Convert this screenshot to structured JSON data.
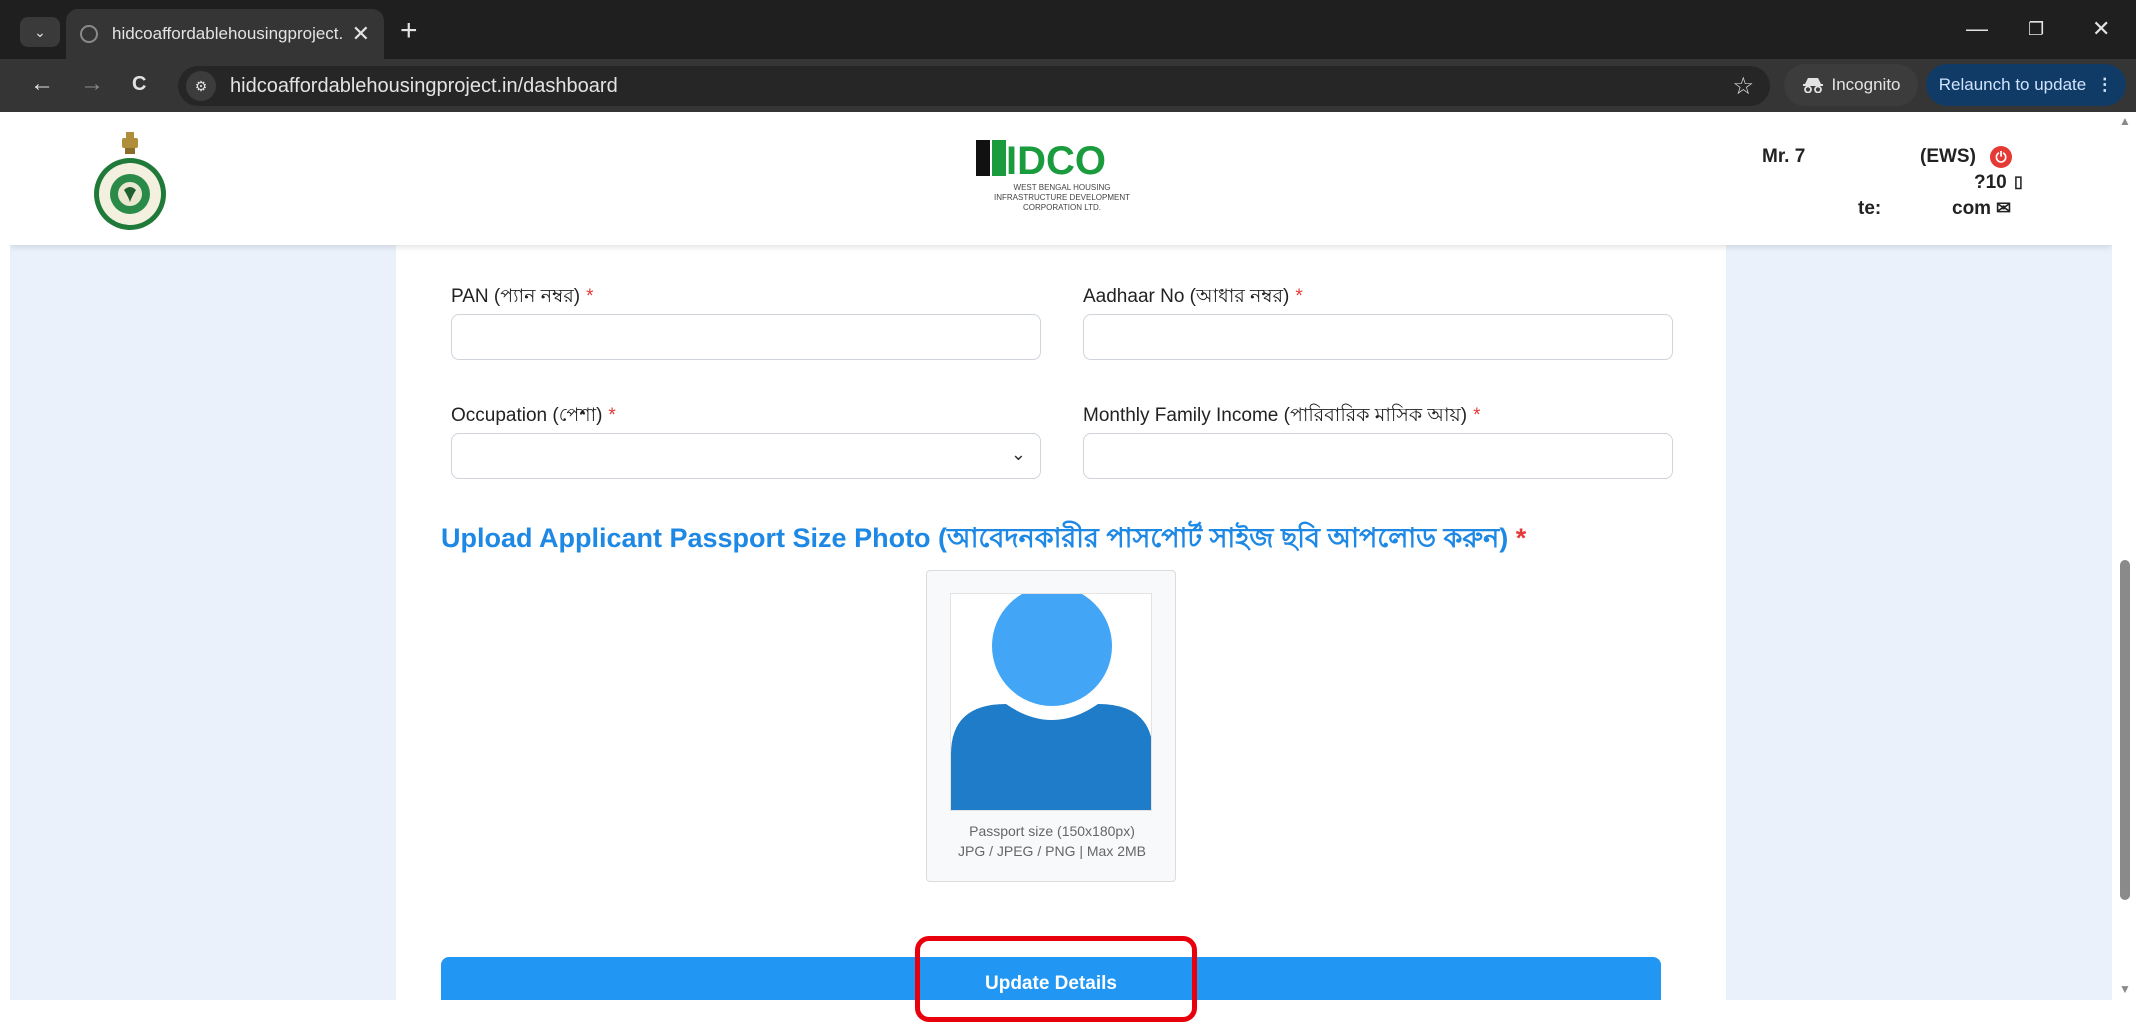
{
  "browser": {
    "tab_title": "hidcoaffordablehousingproject.",
    "tab_close": "✕",
    "new_tab": "+",
    "url": "hidcoaffordablehousingproject.in/dashboard",
    "incognito_label": "Incognito",
    "relaunch_label": "Relaunch to update",
    "back": "←",
    "forward": "→",
    "reload": "C",
    "star": "☆",
    "minimize": "—",
    "restore": "❐",
    "close": "✕"
  },
  "header": {
    "logo_text": "IDCO",
    "logo_subtitle_1": "WEST BENGAL HOUSING",
    "logo_subtitle_2": "INFRASTRUCTURE DEVELOPMENT",
    "logo_subtitle_3": "CORPORATION LTD.",
    "user_name": "Mr. 7",
    "user_category": "(EWS)",
    "user_phone": "?10",
    "user_email_start": "te:",
    "user_email_end": "com"
  },
  "form": {
    "pan_label": "PAN (প্যান নম্বর)",
    "aadhaar_label": "Aadhaar No (আধার নম্বর)",
    "occupation_label": "Occupation (পেশা)",
    "income_label": "Monthly Family Income (পারিবারিক মাসিক আয়)",
    "required_mark": "*",
    "pan_value": "",
    "aadhaar_value": "",
    "occupation_value": "",
    "income_value": "",
    "upload_title": "Upload Applicant Passport Size Photo (আবেদনকারীর পাসপোর্ট সাইজ ছবি আপলোড করুন)",
    "photo_hint_1": "Passport size (150x180px)",
    "photo_hint_2": "JPG / JPEG / PNG | Max 2MB",
    "submit_label": "Update Details"
  },
  "colors": {
    "accent": "#2196f3",
    "heading_blue": "#1e88e5",
    "required_red": "#e53935",
    "highlight_red": "#e8000d",
    "page_bg": "#eaf1fb",
    "avatar_head": "#42a5f5",
    "avatar_body": "#1e7cc8"
  }
}
